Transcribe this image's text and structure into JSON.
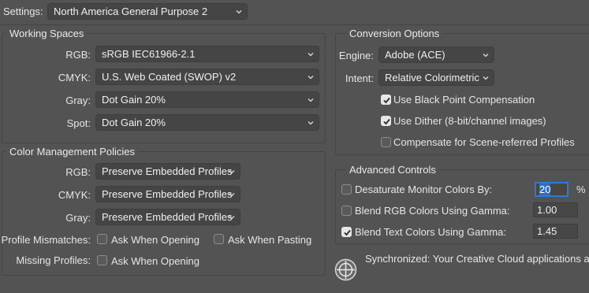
{
  "settings": {
    "label": "Settings:",
    "value": "North America General Purpose 2"
  },
  "working_spaces": {
    "title": "Working Spaces",
    "rgb": {
      "label": "RGB:",
      "value": "sRGB IEC61966-2.1"
    },
    "cmyk": {
      "label": "CMYK:",
      "value": "U.S. Web Coated (SWOP) v2"
    },
    "gray": {
      "label": "Gray:",
      "value": "Dot Gain 20%"
    },
    "spot": {
      "label": "Spot:",
      "value": "Dot Gain 20%"
    }
  },
  "policies": {
    "title": "Color Management Policies",
    "rgb": {
      "label": "RGB:",
      "value": "Preserve Embedded Profiles"
    },
    "cmyk": {
      "label": "CMYK:",
      "value": "Preserve Embedded Profiles"
    },
    "gray": {
      "label": "Gray:",
      "value": "Preserve Embedded Profiles"
    },
    "mismatches": {
      "label": "Profile Mismatches:",
      "ask_opening": {
        "label": "Ask When Opening",
        "checked": false
      },
      "ask_pasting": {
        "label": "Ask When Pasting",
        "checked": false
      }
    },
    "missing": {
      "label": "Missing Profiles:",
      "ask_opening": {
        "label": "Ask When Opening",
        "checked": false
      }
    }
  },
  "conversion": {
    "title": "Conversion Options",
    "engine": {
      "label": "Engine:",
      "value": "Adobe (ACE)"
    },
    "intent": {
      "label": "Intent:",
      "value": "Relative Colorimetric"
    },
    "black_point": {
      "label": "Use Black Point Compensation",
      "checked": true
    },
    "dither": {
      "label": "Use Dither (8-bit/channel images)",
      "checked": true
    },
    "scene_referred": {
      "label": "Compensate for Scene-referred Profiles",
      "checked": false
    }
  },
  "advanced": {
    "title": "Advanced Controls",
    "desaturate": {
      "label": "Desaturate Monitor Colors By:",
      "checked": false,
      "value": "20",
      "unit": "%"
    },
    "blend_rgb": {
      "label": "Blend RGB Colors Using Gamma:",
      "checked": false,
      "value": "1.00"
    },
    "blend_text": {
      "label": "Blend Text Colors Using Gamma:",
      "checked": true,
      "value": "1.45"
    }
  },
  "sync": {
    "icon": "sync-globe-icon",
    "text": "Synchronized: Your Creative Cloud applications ar..."
  },
  "colors": {
    "background": "#535353",
    "control": "#454545",
    "focus": "#2d7ad6"
  }
}
